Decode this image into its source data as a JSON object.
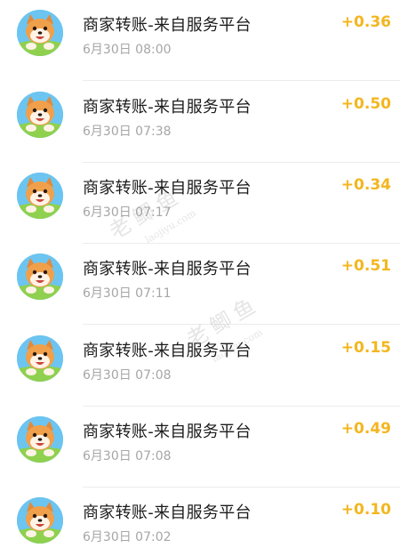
{
  "transactions": [
    {
      "title": "商家转账-来自服务平台",
      "time": "6月30日 08:00",
      "amount": "+0.36"
    },
    {
      "title": "商家转账-来自服务平台",
      "time": "6月30日 07:38",
      "amount": "+0.50"
    },
    {
      "title": "商家转账-来自服务平台",
      "time": "6月30日 07:17",
      "amount": "+0.34"
    },
    {
      "title": "商家转账-来自服务平台",
      "time": "6月30日 07:11",
      "amount": "+0.51"
    },
    {
      "title": "商家转账-来自服务平台",
      "time": "6月30日 07:08",
      "amount": "+0.15"
    },
    {
      "title": "商家转账-来自服务平台",
      "time": "6月30日 07:08",
      "amount": "+0.49"
    },
    {
      "title": "商家转账-来自服务平台",
      "time": "6月30日 07:02",
      "amount": "+0.10"
    }
  ],
  "avatar_icon": "shiba-dog-avatar",
  "watermark": {
    "text": "老鲫鱼",
    "url": "laojiyu.com"
  },
  "colors": {
    "amount": "#f3b61f",
    "title": "#1c1c1c",
    "time": "#a6a6a6",
    "divider": "#ececec"
  }
}
